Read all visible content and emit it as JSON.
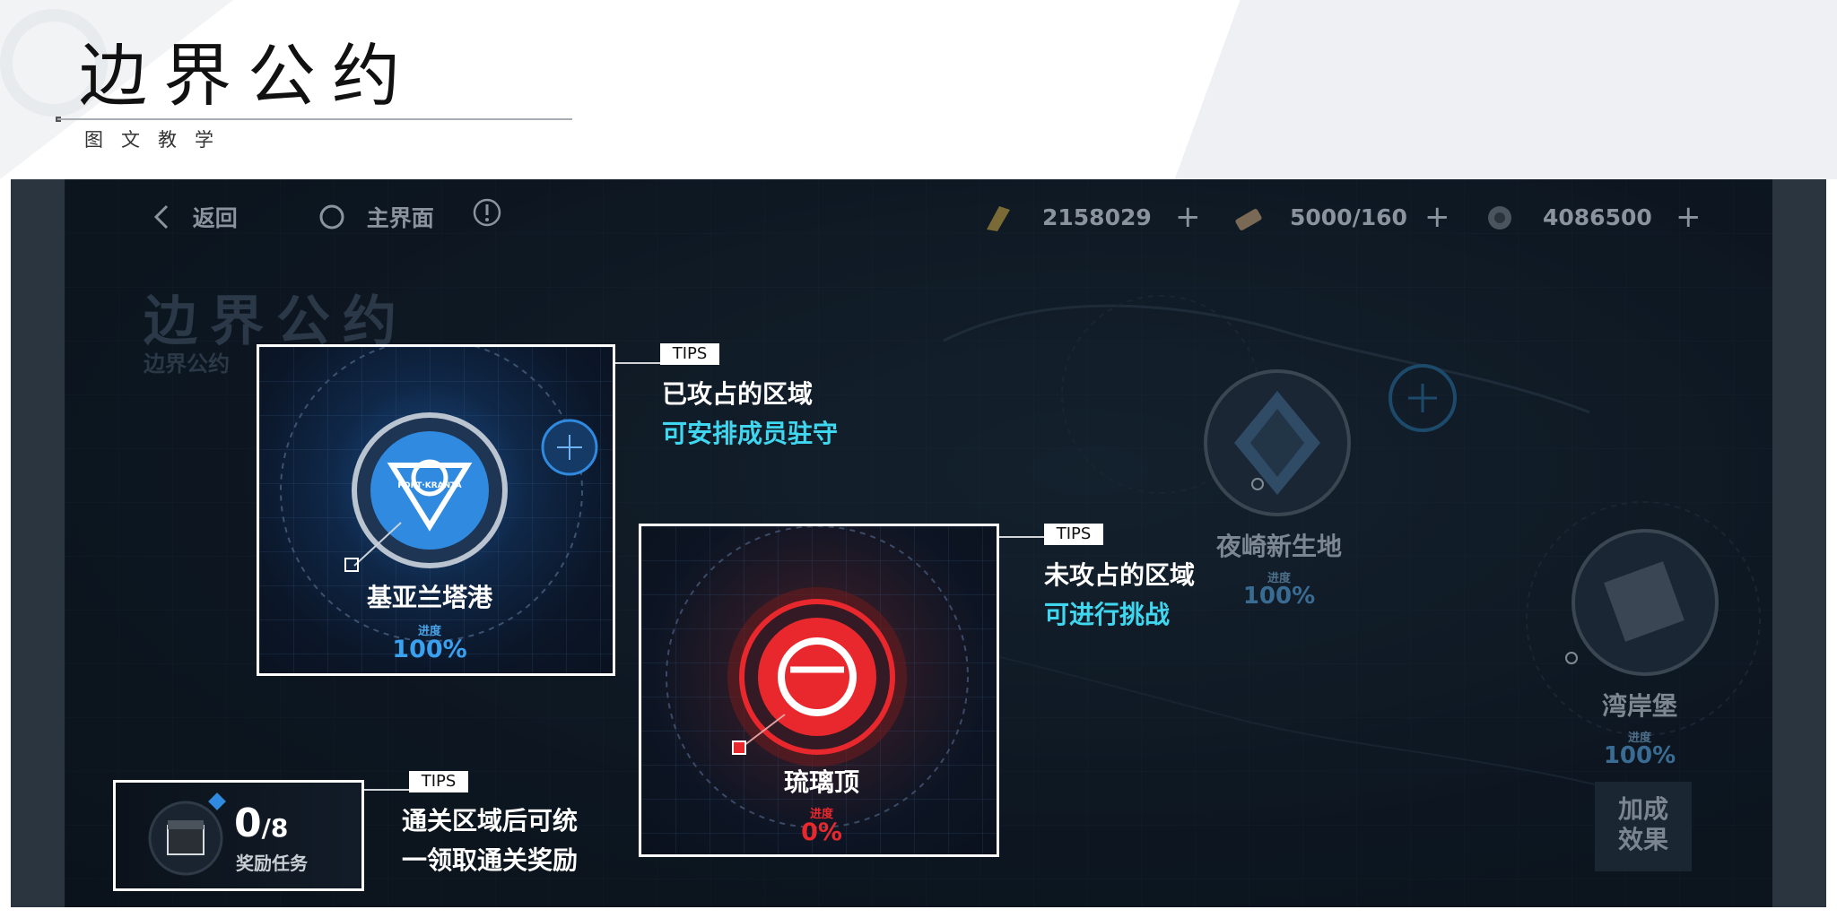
{
  "header": {
    "title": "边界公约",
    "subtitle": "图文教学"
  },
  "game": {
    "topbar": {
      "back_label": "返回",
      "home_label": "主界面",
      "resource1_value": "2158029",
      "resource2_value": "5000/160",
      "resource3_value": "4086500",
      "plus_symbol": "+"
    },
    "background_title": "边界公约",
    "background_subtitle": "边界公约",
    "nodes": {
      "yeqi": {
        "name": "夜崎新生地",
        "progress_label": "进度",
        "progress": "100%"
      },
      "wanan": {
        "name": "湾岸堡",
        "progress_label": "进度",
        "progress": "100%"
      }
    },
    "boost_label": "加成效果",
    "boost_line1": "加成",
    "boost_line2": "效果"
  },
  "tips": {
    "tag": "TIPS",
    "tip1": {
      "node_name": "基亚兰塔港",
      "emblem_text": "PORT·KRANTA",
      "progress_label": "进度",
      "progress": "100%",
      "line1": "已攻占的区域",
      "line2": "可安排成员驻守"
    },
    "tip2": {
      "node_name": "琉璃顶",
      "progress_label": "进度",
      "progress": "0%",
      "line1": "未攻占的区域",
      "line2": "可进行挑战"
    },
    "tip3": {
      "count_big": "0",
      "count_total": "/8",
      "label": "奖励任务",
      "line1": "通关区域后可统",
      "line2": "一领取通关奖励"
    }
  },
  "colors": {
    "accent_cyan": "#3fd7f0",
    "captured_blue": "#2f8ae0",
    "uncaptured_red": "#e8282c"
  }
}
